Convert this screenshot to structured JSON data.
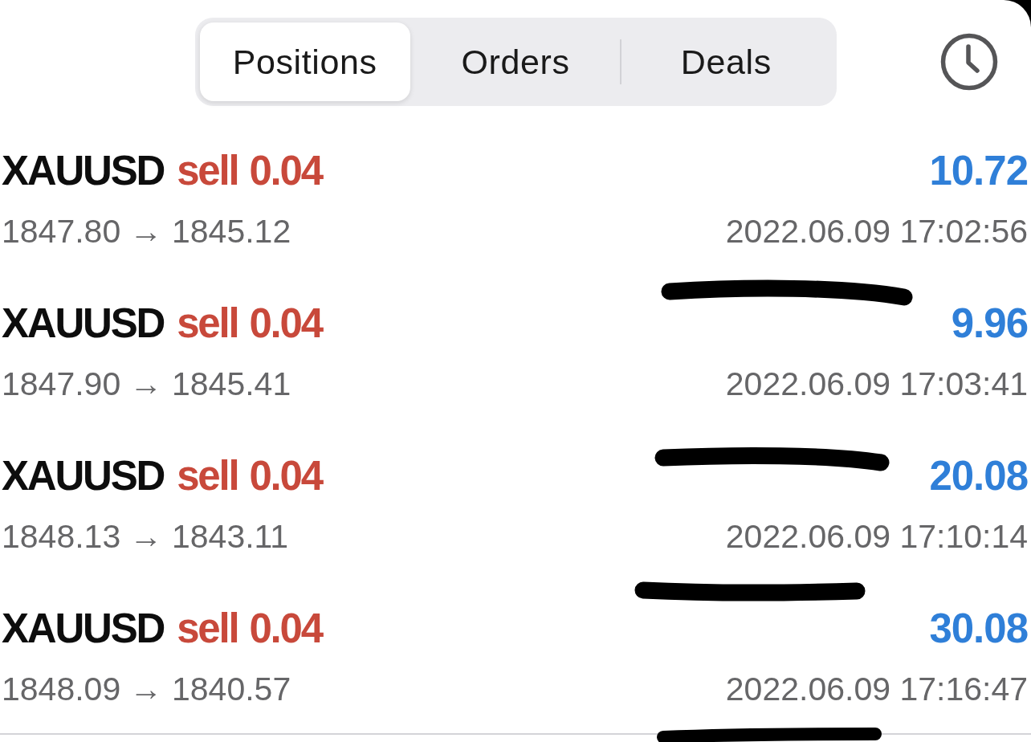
{
  "tabs": [
    {
      "label": "Positions",
      "selected": true
    },
    {
      "label": "Orders",
      "selected": false
    },
    {
      "label": "Deals",
      "selected": false
    }
  ],
  "positions": [
    {
      "symbol": "XAUUSD",
      "side": "sell",
      "volume": "0.04",
      "prices": "1847.80 → 1845.12",
      "profit": "10.72",
      "time": "2022.06.09 17:02:56"
    },
    {
      "symbol": "XAUUSD",
      "side": "sell",
      "volume": "0.04",
      "prices": "1847.90 → 1845.41",
      "profit": "9.96",
      "time": "2022.06.09 17:03:41"
    },
    {
      "symbol": "XAUUSD",
      "side": "sell",
      "volume": "0.04",
      "prices": "1848.13 → 1843.11",
      "profit": "20.08",
      "time": "2022.06.09 17:10:14"
    },
    {
      "symbol": "XAUUSD",
      "side": "sell",
      "volume": "0.04",
      "prices": "1848.09 → 1840.57",
      "profit": "30.08",
      "time": "2022.06.09 17:16:47"
    }
  ]
}
